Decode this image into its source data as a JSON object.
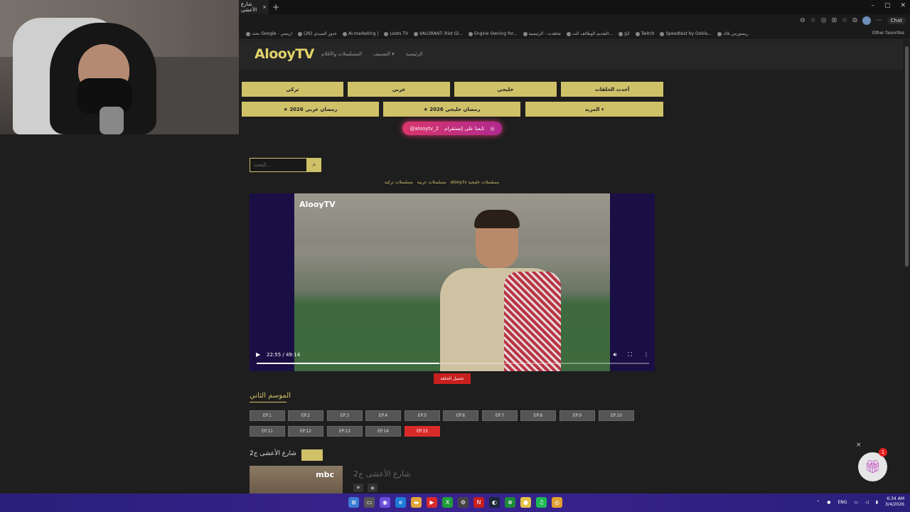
{
  "browser": {
    "tab_title": "شارع الأعشى",
    "tab_close": "×",
    "new_tab": "+",
    "chat_label": "Chat",
    "bookmarks": [
      "بحث Google - ارينمي",
      "عدوز الصيدي (26)",
      "AI.marketing |",
      "Loots TV",
      "VALORANT: Riot Gl...",
      "Engine Owning for...",
      "شاهدت - الرئيسية",
      "التقديم الوظائف الت...",
      "g2",
      "Twitch",
      "Speedtest by Ookla...",
      "ريسورس بلاك"
    ],
    "other_favorites": "Other favorites",
    "window_controls": [
      "–",
      "▢",
      "✕"
    ]
  },
  "site": {
    "logo": "AlooyTV",
    "nav": [
      "المسلسلات والأفلام",
      "التصنيف ▾",
      "الرئيسية"
    ],
    "categories_row1": [
      "تركي",
      "عربي",
      "خليجي",
      "أحدث الحلقات"
    ],
    "categories_row2": [
      "★ رمضان عربي 2026",
      "★ رمضان خليجي 2026",
      "المزيد ▾"
    ],
    "instagram_handle": "@alooytv_2",
    "instagram_text": "تابعنا على إنستقرام",
    "search_placeholder": "البحث...",
    "search_icon": "search-icon",
    "breadcrumb": [
      "alooy.tv مسلسلات خليجية",
      "مسلسلات عربية",
      "مسلسلات تركية"
    ]
  },
  "player": {
    "watermark": "AlooyTV",
    "current_time": "22:55",
    "duration": "49:14",
    "time_display": "22:55 / 49:14",
    "progress": 0.465,
    "download_label": "تحميل الحلقة"
  },
  "season": {
    "title": "الموسم الثاني",
    "episodes": [
      "EP.1",
      "EP.2",
      "EP.3",
      "EP.4",
      "EP.5",
      "EP.6",
      "EP.7",
      "EP.8",
      "EP.9",
      "EP.10",
      "EP.11",
      "EP.12",
      "EP.13",
      "EP.14",
      "EP.15"
    ],
    "active_episode": "EP.15"
  },
  "related": {
    "title": "شارع الأعشى ج2",
    "card_title": "شارع الأعشى ج2",
    "card_logo": "mbc"
  },
  "widget": {
    "badge_count": "1",
    "close": "×"
  },
  "taskbar": {
    "lang": "ENG",
    "time": "6:34 AM",
    "date": "3/4/2026"
  },
  "colors": {
    "accent": "#cfc168",
    "active_red": "#d92a2a",
    "instagram": "#d9366b"
  }
}
